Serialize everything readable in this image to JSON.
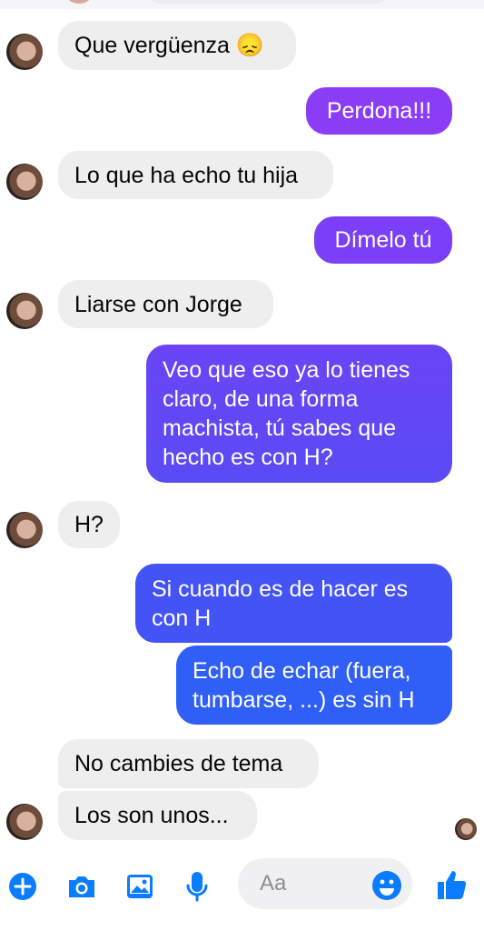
{
  "conversation": {
    "messages": [
      {
        "side": "in",
        "text": "Que vergüenza 😞"
      },
      {
        "side": "out",
        "text": "Perdona!!!"
      },
      {
        "side": "in",
        "text": "Lo que ha echo tu hija"
      },
      {
        "side": "out",
        "text": "Dímelo tú"
      },
      {
        "side": "in",
        "text": "Liarse con Jorge"
      },
      {
        "side": "out",
        "text": "Veo que eso ya lo tienes claro, de una forma machista, tú sabes que hecho es con H?"
      },
      {
        "side": "in",
        "text": "H?"
      },
      {
        "side": "out",
        "text": "Si cuando es de hacer es con H"
      },
      {
        "side": "out",
        "text": "Echo de echar (fuera, tumbarse, ...) es sin H"
      },
      {
        "side": "in",
        "text": "No cambies de tema"
      },
      {
        "side": "in",
        "text": "Los son unos..."
      }
    ]
  },
  "composer": {
    "placeholder": "Aa",
    "icons": [
      "plus-icon",
      "camera-icon",
      "gallery-icon",
      "microphone-icon",
      "emoji-icon",
      "thumbs-up-icon"
    ]
  },
  "colors": {
    "incoming_bubble": "#eeeeef",
    "outgoing_gradient": [
      "#8b3cf7",
      "#4f4ff5",
      "#2f60f7"
    ],
    "accent": "#0a7cff"
  }
}
